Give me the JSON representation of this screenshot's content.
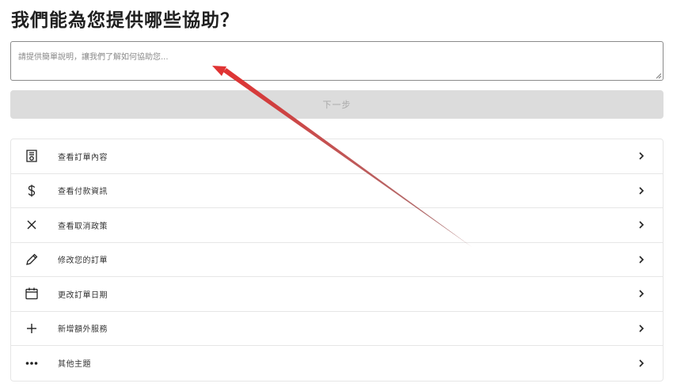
{
  "page": {
    "title": "我們能為您提供哪些協助？"
  },
  "description": {
    "value": "",
    "placeholder": "請提供簡單說明，讓我們了解如何協助您..."
  },
  "next_button": {
    "label": "下一步"
  },
  "topics": [
    {
      "label": "查看訂單內容",
      "icon": "receipt-icon"
    },
    {
      "label": "查看付款資訊",
      "icon": "dollar-icon"
    },
    {
      "label": "查看取消政策",
      "icon": "close-icon"
    },
    {
      "label": "修改您的訂單",
      "icon": "pencil-icon"
    },
    {
      "label": "更改訂單日期",
      "icon": "calendar-icon"
    },
    {
      "label": "新增額外服務",
      "icon": "plus-icon"
    },
    {
      "label": "其他主題",
      "icon": "more-dots-icon"
    }
  ],
  "colors": {
    "button_disabled_bg": "#dcdcdc",
    "button_disabled_text": "#a9a9a9",
    "annotation_arrow": "#d93a3a"
  }
}
